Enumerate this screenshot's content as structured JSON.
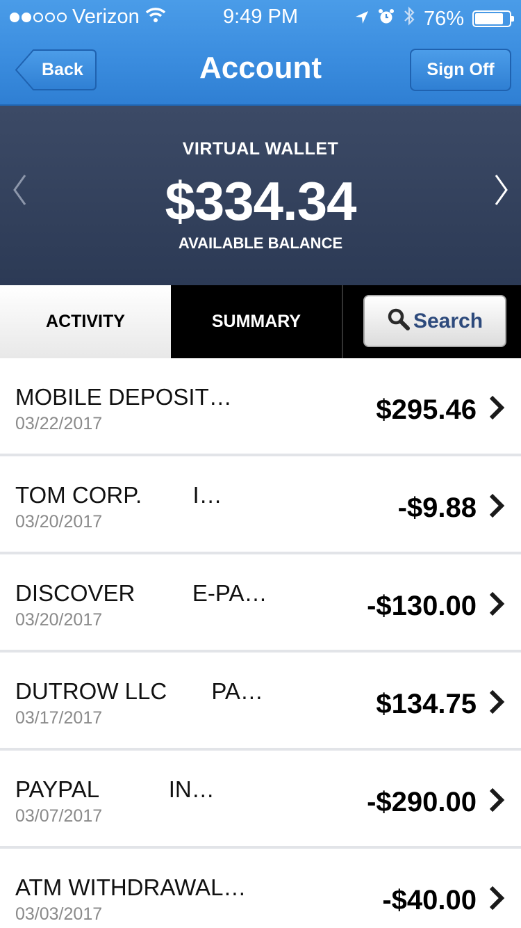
{
  "status_bar": {
    "carrier": "Verizon",
    "time": "9:49 PM",
    "battery": "76%",
    "signal_bars_filled": 2,
    "signal_bars_total": 5
  },
  "nav": {
    "back_label": "Back",
    "title": "Account",
    "signoff_label": "Sign Off"
  },
  "balance": {
    "account_name": "VIRTUAL WALLET",
    "amount": "$334.34",
    "caption": "AVAILABLE BALANCE"
  },
  "tabs": {
    "activity": "ACTIVITY",
    "summary": "SUMMARY",
    "search": "Search"
  },
  "transactions": [
    {
      "description": "MOBILE DEPOSIT…",
      "date": "03/22/2017",
      "amount": "$295.46"
    },
    {
      "description": "TOM CORP.        I…",
      "date": "03/20/2017",
      "amount": "-$9.88"
    },
    {
      "description": "DISCOVER         E-PA…",
      "date": "03/20/2017",
      "amount": "-$130.00"
    },
    {
      "description": "DUTROW LLC       PA…",
      "date": "03/17/2017",
      "amount": "$134.75"
    },
    {
      "description": "PAYPAL           IN…",
      "date": "03/07/2017",
      "amount": "-$290.00"
    },
    {
      "description": "ATM WITHDRAWAL…",
      "date": "03/03/2017",
      "amount": "-$40.00"
    }
  ],
  "colors": {
    "header_blue": "#3b8ddf",
    "balance_panel": "#34425e",
    "search_text": "#2d4a7c"
  },
  "icons": [
    "wifi-icon",
    "location-icon",
    "alarm-icon",
    "bluetooth-icon",
    "battery-icon",
    "chevron-left-icon",
    "chevron-right-icon",
    "search-icon"
  ]
}
